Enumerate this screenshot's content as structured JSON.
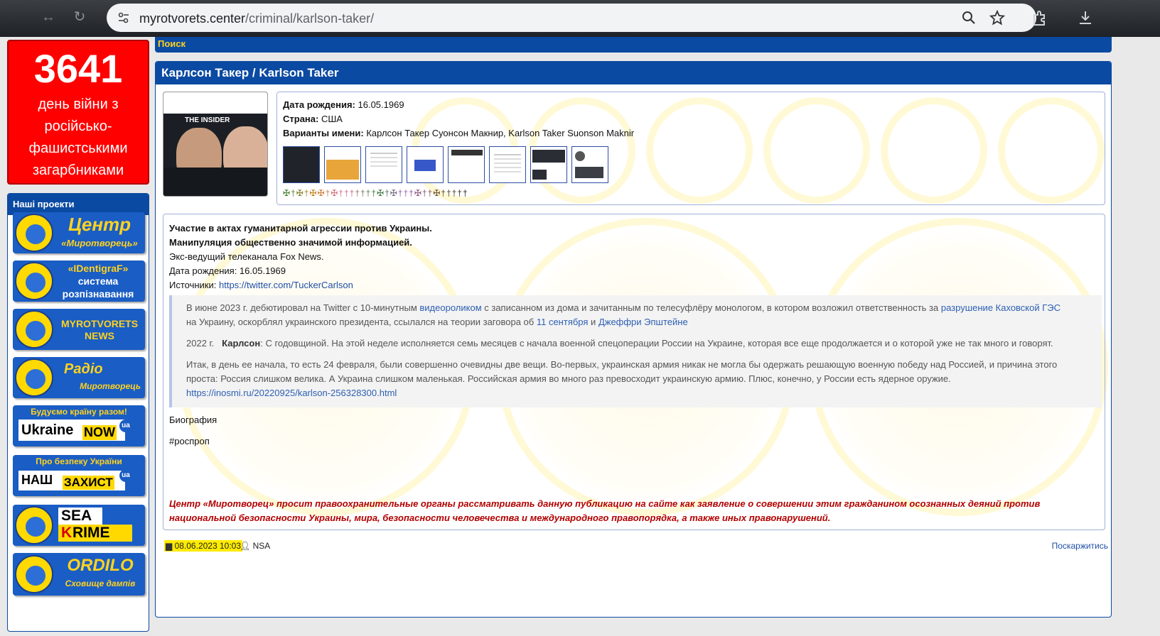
{
  "browser": {
    "url_host": "myrotvorets.center",
    "url_path": "/criminal/karlson-taker/"
  },
  "counter": {
    "number": "3641",
    "text_lines": [
      "день війни з",
      "російсько-",
      "фашистськими",
      "загарбниками"
    ]
  },
  "projects": {
    "title": "Наші проекти",
    "items": [
      {
        "line1": "Центр",
        "line2": "«Миротворець»"
      },
      {
        "line1": "«IDentigraF»",
        "line2": "система",
        "line3": "розпізнавання",
        "emblem_text": "IDENTIGRAF"
      },
      {
        "line1": "MYROTVORETS",
        "line2": "NEWS"
      },
      {
        "line1": "Радіо",
        "line2": "Миротворець"
      },
      {
        "line1": "Будуємо країну разом!",
        "line2": "Ukraine",
        "line3": "NOW",
        "badge": "ua"
      },
      {
        "line1": "Про безпеку України",
        "line2": "НАШ",
        "line3": "ЗАХИСТ",
        "badge": "ua"
      },
      {
        "line1": "SEA",
        "line2": "K",
        "line3": "RIME"
      },
      {
        "line1": "ORDILO",
        "line2": "Сховище дампів"
      }
    ]
  },
  "topbar": {
    "search_label": "Поиск"
  },
  "record": {
    "title": "Карлсон Такер / Karlson Taker",
    "birth_label": "Дата рождения:",
    "birth_value": "16.05.1969",
    "country_label": "Страна:",
    "country_value": "США",
    "names_label": "Варианты имени:",
    "names_value": "Карлсон Такер Суонсон Макнир, Karlson Taker Suonson Maknir",
    "photo_caption": "THE INSIDER",
    "crosses": "✠†✠†✠✠†✠†††††††✠†✠†††✠††✠†††††",
    "charges_1": "Участие в актах гуманитарной агрессии против Украины.",
    "charges_2": "Манипуляция общественно значимой информацией.",
    "description": "Экс-ведущий телеканала Fox News.",
    "birth_line": "Дата рождения: 16.05.1969",
    "sources_label": "Источники:",
    "sources_link": "https://twitter.com/TuckerCarlson",
    "quote": {
      "p1_a": "В июне 2023 г. дебютировал на Twitter с 10-минутным ",
      "p1_link1": "видеороликом",
      "p1_b": " с записанном из дома и зачитанным по телесуфлёру монологом, в котором возложил ответственность за ",
      "p1_link2": "разрушение Каховской ГЭС",
      "p1_c": "на Украину, оскорблял украинского президента, ссылался на теории заговора об ",
      "p1_link3": "11 сентября",
      "p1_d": " и ",
      "p1_link4": "Джеффри Эпштейне",
      "p2_year": "2022 г.",
      "p2_name": "Карлсон",
      "p2_text": ": С годовщиной. На этой неделе исполняется семь месяцев с начала военной спецоперации России на Украине, которая все еще продолжается и о которой уже не так много и говорят.",
      "p3_a": "Итак, в день ее начала, то есть 24 февраля, были совершенно очевидны две вещи. Во-первых, украинская армия никак не могла бы одержать решающую военную победу над Россией, и причина этого",
      "p3_b": "проста: Россия слишком велика. А Украина слишком маленькая. Российская армия во много раз превосходит украинскую армию. Плюс, конечно, у России есть ядерное оружие.",
      "p3_link": "https://inosmi.ru/20220925/karlson-256328300.html"
    },
    "biography": "Биография",
    "hashtag": "#роспроп",
    "disclaimer_1": "Центр «Миротворец» просит правоохранительные органы рассматривать данную публикацию на сайте как заявление о совершении этим гражданином осознанных деяний против",
    "disclaimer_2": "национальной безопасности Украины, мира, безопасности человечества и международного правопорядка, а также иных правонарушений.",
    "date": "08.06.2023 10:03",
    "author": "NSA",
    "complain": "Поскаржитись"
  },
  "colors": {
    "brand_blue": "#0b4aa2",
    "counter_red": "#ff0000",
    "highlight": "#ffeb00",
    "warning_red": "#b30000"
  }
}
